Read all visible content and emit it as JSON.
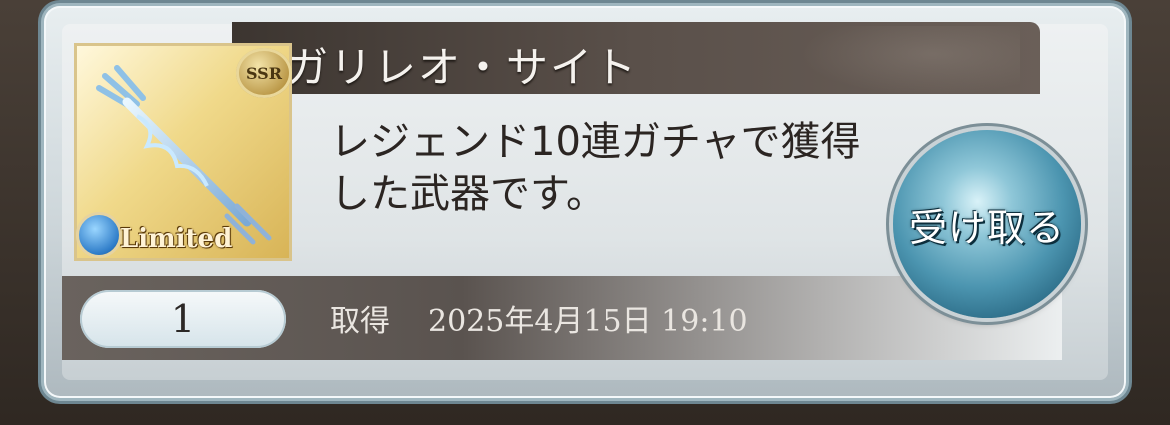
{
  "item": {
    "name": "ガリレオ・サイト",
    "description": "レジェンド10連ガチャで獲得した武器です。",
    "rarity": "SSR",
    "tag": "Limited",
    "element_icon": "water-element-icon",
    "quantity": "1"
  },
  "acquired": {
    "label": "取得",
    "datetime": "2025年4月15日 19:10"
  },
  "actions": {
    "receive_label": "受け取る"
  }
}
